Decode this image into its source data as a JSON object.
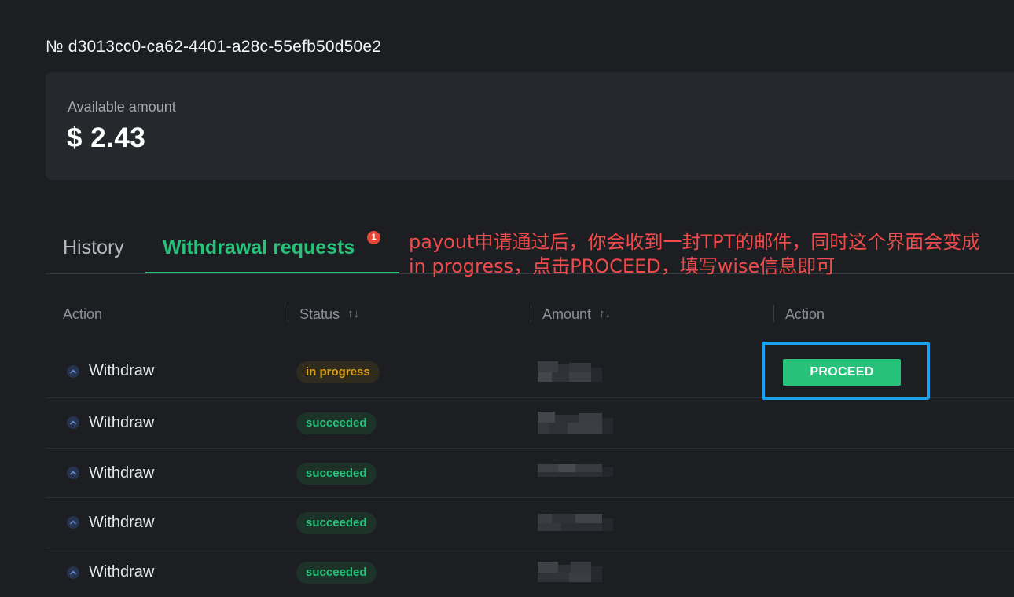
{
  "wallet": {
    "id_text": "№ d3013cc0-ca62-4401-a28c-55efb50d50e2"
  },
  "balance": {
    "label": "Available amount",
    "value": "$ 2.43"
  },
  "tabs": [
    {
      "label": "History",
      "active": false
    },
    {
      "label": "Withdrawal requests",
      "active": true,
      "badge": "1"
    }
  ],
  "annotation": {
    "line1": "payout申请通过后，你会收到一封TPT的邮件，同时这个界面会变成",
    "line2": "in progress，点击PROCEED，填写wise信息即可",
    "color": "#f04b4b"
  },
  "table": {
    "columns": [
      {
        "label": "Action",
        "sortable": false
      },
      {
        "label": "Status",
        "sortable": true
      },
      {
        "label": "Amount",
        "sortable": true
      },
      {
        "label": "Action",
        "sortable": false
      }
    ],
    "rows": [
      {
        "action": "Withdraw",
        "status": "in progress",
        "amount": "",
        "button": "PROCEED"
      },
      {
        "action": "Withdraw",
        "status": "succeeded",
        "amount": ""
      },
      {
        "action": "Withdraw",
        "status": "succeeded",
        "amount": ""
      },
      {
        "action": "Withdraw",
        "status": "succeeded",
        "amount": ""
      },
      {
        "action": "Withdraw",
        "status": "succeeded",
        "amount": ""
      }
    ]
  },
  "colors": {
    "accent": "#27c17a",
    "in_progress": "#d6a019",
    "badge": "#e7453a",
    "highlight_frame": "#1aa3ec"
  },
  "icons": {
    "row_direction": "arrow-up-icon",
    "sort": "sort-icon"
  }
}
